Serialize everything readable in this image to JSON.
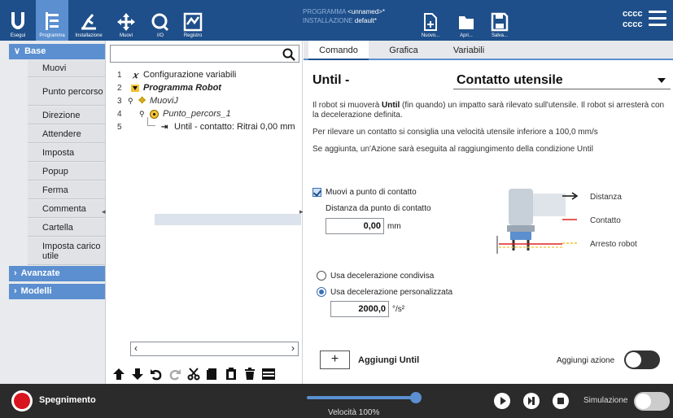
{
  "colors": {
    "topbar": "#1e4f8a",
    "accent": "#5b8fd0",
    "bottombar": "#2b2b2b",
    "power": "#d8141e",
    "contact_line": "#e02020",
    "stop_line": "#f2c230"
  },
  "topbar": {
    "nav": [
      {
        "label": "Esegui",
        "icon": "logo-icon"
      },
      {
        "label": "Programma",
        "icon": "program-icon"
      },
      {
        "label": "Installazione",
        "icon": "installation-icon"
      },
      {
        "label": "Muovi",
        "icon": "move-icon"
      },
      {
        "label": "I/O",
        "icon": "io-icon"
      },
      {
        "label": "Registro",
        "icon": "log-icon"
      }
    ],
    "program_label": "PROGRAMMA",
    "program_value": "<unnamed>*",
    "install_label": "INSTALLAZIONE",
    "install_value": "default*",
    "file_buttons": [
      {
        "label": "Nuovo...",
        "icon": "new-file-icon"
      },
      {
        "label": "Apri...",
        "icon": "folder-icon"
      },
      {
        "label": "Salva...",
        "icon": "save-icon"
      }
    ],
    "user_line1": "cccc",
    "user_line2": "cccc"
  },
  "sidebar": {
    "base_label": "Base",
    "items": [
      "Muovi",
      "Punto percorso",
      "Direzione",
      "Attendere",
      "Imposta",
      "Popup",
      "Ferma",
      "Commenta",
      "Cartella",
      "Imposta carico utile"
    ],
    "categories": [
      "Avanzate",
      "Modelli"
    ]
  },
  "tree": {
    "search_placeholder": "",
    "rows": [
      {
        "num": "1",
        "text": "Configurazione variabili"
      },
      {
        "num": "2",
        "text": "Programma Robot"
      },
      {
        "num": "3",
        "text": "MuoviJ"
      },
      {
        "num": "4",
        "text": "Punto_percors_1"
      },
      {
        "num": "5",
        "text": "Until - contatto: Ritrai 0,00 mm"
      }
    ]
  },
  "tabs": [
    "Comando",
    "Grafica",
    "Variabili"
  ],
  "command": {
    "title": "Until -",
    "condition": "Contatto utensile",
    "desc1_a": "Il robot si muoverà",
    "desc1_b": "Until",
    "desc1_c": "(fin quando) un impatto sarà rilevato sull'utensile. Il robot si arresterà con la decelerazione definita.",
    "desc2": "Per rilevare un contatto si consiglia una velocità utensile inferiore a 100,0 mm/s",
    "desc3": "Se aggiunta, un'Azione sarà eseguita al raggiungimento della condizione Until",
    "checkbox_label": "Muovi a punto di contatto",
    "distance_label": "Distanza da punto di contatto",
    "distance_value": "0,00",
    "distance_unit": "mm",
    "legend": [
      "Distanza",
      "Contatto",
      "Arresto robot"
    ],
    "radio_shared": "Usa decelerazione condivisa",
    "radio_custom": "Usa decelerazione personalizzata",
    "decel_value": "2000,0",
    "decel_unit": "°/s²",
    "add_until_label": "Aggiungi Until",
    "add_action_label": "Aggiungi azione"
  },
  "bottom": {
    "power_label": "Spegnimento",
    "speed_label": "Velocità 100%",
    "speed_value": 1.0,
    "sim_label": "Simulazione"
  }
}
